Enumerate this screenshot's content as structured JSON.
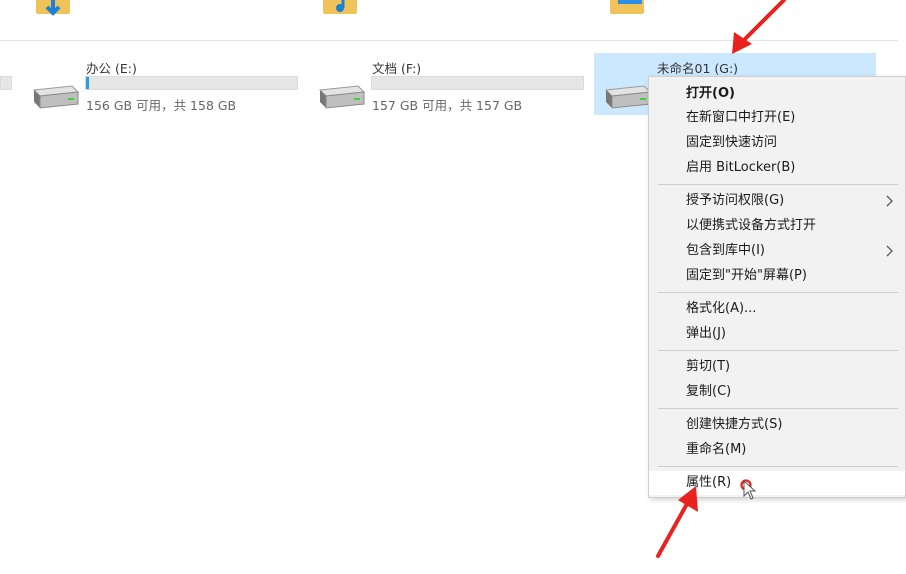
{
  "drives": [
    {
      "label": "办公 (E:)",
      "size": "156 GB 可用，共 158 GB",
      "used_fraction": 0.013
    },
    {
      "label": "文档 (F:)",
      "size": "157 GB 可用，共 157 GB",
      "used_fraction": 0.0
    },
    {
      "label": "未命名01 (G:)",
      "size": "",
      "used_fraction": 0.0
    }
  ],
  "context_menu": {
    "items": [
      {
        "label": "打开(O)",
        "bold": true
      },
      {
        "label": "在新窗口中打开(E)"
      },
      {
        "label": "固定到快速访问"
      },
      {
        "label": "启用 BitLocker(B)"
      },
      {
        "label": "授予访问权限(G)",
        "submenu": true
      },
      {
        "label": "以便携式设备方式打开"
      },
      {
        "label": "包含到库中(I)",
        "submenu": true
      },
      {
        "label": "固定到\"开始\"屏幕(P)"
      },
      {
        "label": "格式化(A)..."
      },
      {
        "label": "弹出(J)"
      },
      {
        "label": "剪切(T)"
      },
      {
        "label": "复制(C)"
      },
      {
        "label": "创建快捷方式(S)"
      },
      {
        "label": "重命名(M)"
      },
      {
        "label": "属性(R)",
        "hovered": true
      }
    ]
  },
  "colors": {
    "selection": "#cce8ff",
    "progress": "#26a0da",
    "annotation_arrow": "#e8231f"
  }
}
